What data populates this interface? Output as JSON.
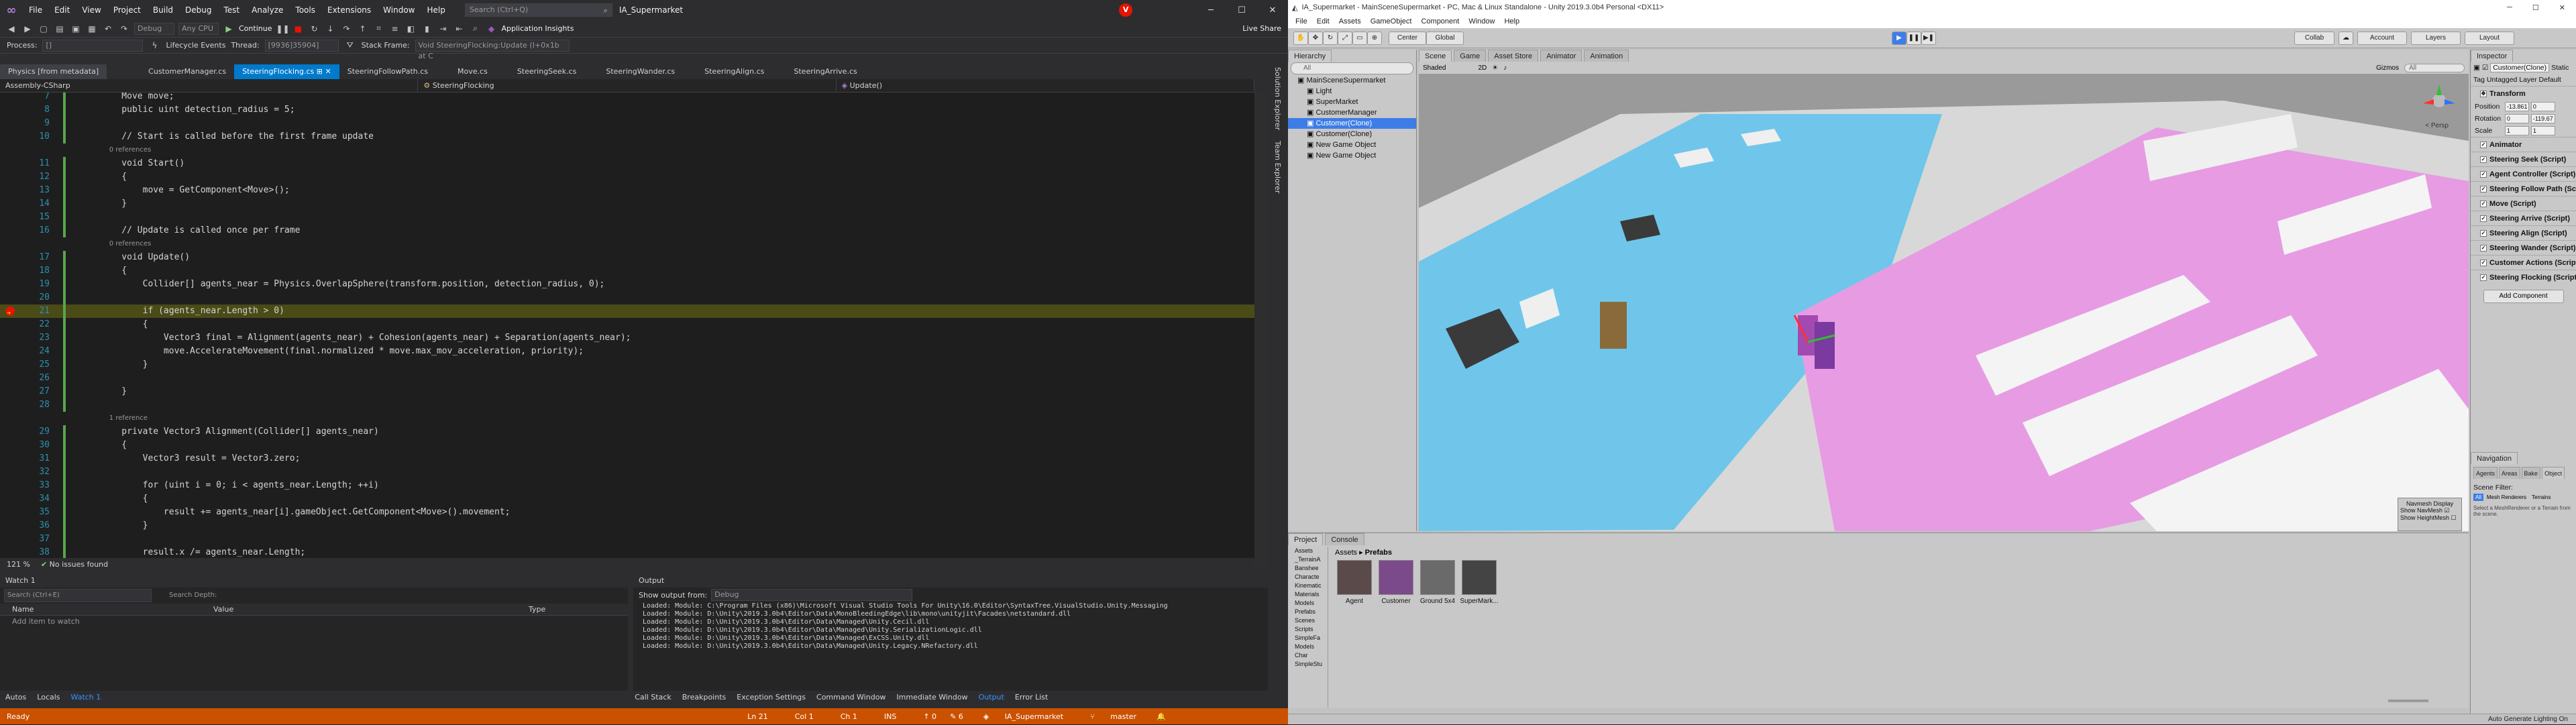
{
  "vs": {
    "menu": [
      "File",
      "Edit",
      "View",
      "Project",
      "Build",
      "Debug",
      "Test",
      "Analyze",
      "Tools",
      "Extensions",
      "Window",
      "Help"
    ],
    "search_placeholder": "Search (Ctrl+Q)",
    "solution": "IA_Supermarket",
    "live_share": "Live Share",
    "toolbar": {
      "config": "Debug",
      "platform": "Any CPU",
      "continue": "Continue",
      "app_insights": "Application Insights"
    },
    "process_bar": {
      "process_label": "Process:",
      "process_value": "[]",
      "lifecycle": "Lifecycle Events",
      "thread_label": "Thread:",
      "thread_value": "[9936]35904]",
      "stackframe_label": "Stack Frame:",
      "stackframe_value": "Void SteeringFlocking:Update (I+0x1b at C"
    },
    "tabs": [
      "Physics [from metadata]",
      "CustomerManager.cs",
      "SteeringFlocking.cs",
      "SteeringFollowPath.cs",
      "Move.cs",
      "SteeringSeek.cs",
      "SteeringWander.cs",
      "SteeringAlign.cs",
      "SteeringArrive.cs"
    ],
    "nav": {
      "project": "Assembly-CSharp",
      "class": "SteeringFlocking",
      "method": "Update()"
    },
    "code_lines": [
      {
        "n": "7",
        "text": "    Move move;"
      },
      {
        "n": "8",
        "text": "    public uint detection_radius = 5;"
      },
      {
        "n": "9",
        "text": ""
      },
      {
        "n": "10",
        "text": "    // Start is called before the first frame update"
      },
      {
        "n": "",
        "text": "    0 references"
      },
      {
        "n": "11",
        "text": "    void Start()"
      },
      {
        "n": "12",
        "text": "    {"
      },
      {
        "n": "13",
        "text": "        move = GetComponent<Move>();"
      },
      {
        "n": "14",
        "text": "    }"
      },
      {
        "n": "15",
        "text": ""
      },
      {
        "n": "16",
        "text": "    // Update is called once per frame"
      },
      {
        "n": "",
        "text": "    0 references"
      },
      {
        "n": "17",
        "text": "    void Update()"
      },
      {
        "n": "18",
        "text": "    {"
      },
      {
        "n": "19",
        "text": "        Collider[] agents_near = Physics.OverlapSphere(transform.position, detection_radius, 0);"
      },
      {
        "n": "20",
        "text": ""
      },
      {
        "n": "21",
        "text": "        if (agents_near.Length > 0)"
      },
      {
        "n": "22",
        "text": "        {"
      },
      {
        "n": "23",
        "text": "            Vector3 final = Alignment(agents_near) + Cohesion(agents_near) + Separation(agents_near);"
      },
      {
        "n": "24",
        "text": "            move.AccelerateMovement(final.normalized * move.max_mov_acceleration, priority);"
      },
      {
        "n": "25",
        "text": "        }"
      },
      {
        "n": "26",
        "text": ""
      },
      {
        "n": "27",
        "text": "    }"
      },
      {
        "n": "28",
        "text": ""
      },
      {
        "n": "",
        "text": "    1 reference"
      },
      {
        "n": "29",
        "text": "    private Vector3 Alignment(Collider[] agents_near)"
      },
      {
        "n": "30",
        "text": "    {"
      },
      {
        "n": "31",
        "text": "        Vector3 result = Vector3.zero;"
      },
      {
        "n": "32",
        "text": ""
      },
      {
        "n": "33",
        "text": "        for (uint i = 0; i < agents_near.Length; ++i)"
      },
      {
        "n": "34",
        "text": "        {"
      },
      {
        "n": "35",
        "text": "            result += agents_near[i].gameObject.GetComponent<Move>().movement;"
      },
      {
        "n": "36",
        "text": "        }"
      },
      {
        "n": "37",
        "text": ""
      },
      {
        "n": "38",
        "text": "        result.x /= agents_near.Length;"
      }
    ],
    "editor_status": {
      "zoom": "121 %",
      "issues": "No issues found"
    },
    "watch": {
      "title": "Watch 1",
      "search_placeholder": "Search (Ctrl+E)",
      "search_depth": "Search Depth:",
      "columns": [
        "Name",
        "Value",
        "Type"
      ],
      "add_item": "Add item to watch"
    },
    "output": {
      "title": "Output",
      "show_from_label": "Show output from:",
      "show_from_value": "Debug",
      "lines": [
        "Loaded: Module: C:\\Program Files (x86)\\Microsoft Visual Studio Tools For Unity\\16.0\\Editor\\SyntaxTree.VisualStudio.Unity.Messaging",
        "Loaded: Module: D:\\Unity\\2019.3.0b4\\Editor\\Data\\MonoBleedingEdge\\lib\\mono\\unityjit\\Facades\\netstandard.dll",
        "Loaded: Module: D:\\Unity\\2019.3.0b4\\Editor\\Data\\Managed\\Unity.Cecil.dll",
        "Loaded: Module: D:\\Unity\\2019.3.0b4\\Editor\\Data\\Managed\\Unity.SerializationLogic.dll",
        "Loaded: Module: D:\\Unity\\2019.3.0b4\\Editor\\Data\\Managed\\ExCSS.Unity.dll",
        "Loaded: Module: D:\\Unity\\2019.3.0b4\\Editor\\Data\\Managed\\Unity.Legacy.NRefactory.dll"
      ]
    },
    "bottom_tabs_left": [
      "Autos",
      "Locals",
      "Watch 1"
    ],
    "bottom_tabs_right": [
      "Call Stack",
      "Breakpoints",
      "Exception Settings",
      "Command Window",
      "Immediate Window",
      "Output",
      "Error List"
    ],
    "status": {
      "ready": "Ready",
      "ln": "Ln 21",
      "col": "Col 1",
      "ch": "Ch 1",
      "ins": "INS",
      "arrows": "↑ 0",
      "pencil": "✎ 6",
      "repo": "IA_Supermarket",
      "branch": "master"
    },
    "right_strip": [
      "Solution Explorer",
      "Team Explorer"
    ]
  },
  "unity": {
    "title": "IA_Supermarket - MainSceneSupermarket - PC, Mac & Linux Standalone - Unity 2019.3.0b4 Personal <DX11>",
    "menu": [
      "File",
      "Edit",
      "Assets",
      "GameObject",
      "Component",
      "Window",
      "Help"
    ],
    "toolbar": {
      "center": "Center",
      "global": "Global",
      "collab": "Collab",
      "account": "Account",
      "layers": "Layers",
      "layout": "Layout"
    },
    "hierarchy": {
      "tab": "Hierarchy",
      "search_placeholder": "All",
      "rows": [
        {
          "label": "MainSceneSupermarket",
          "indent": 1
        },
        {
          "label": "Light",
          "indent": 2
        },
        {
          "label": "SuperMarket",
          "indent": 2
        },
        {
          "label": "CustomerManager",
          "indent": 2
        },
        {
          "label": "Customer(Clone)",
          "indent": 2,
          "selected": true
        },
        {
          "label": "Customer(Clone)",
          "indent": 2
        },
        {
          "label": "New Game Object",
          "indent": 2
        },
        {
          "label": "New Game Object",
          "indent": 2
        }
      ]
    },
    "scene_tabs": [
      "Scene",
      "Game",
      "Asset Store",
      "Animator",
      "Animation"
    ],
    "scene_shading": "Shaded",
    "scene_gizmos": "Gizmos",
    "scene_search": "All",
    "persp_label": "< Persp",
    "navmesh_overlay": {
      "title": "Navmesh Display",
      "show_navmesh": "Show NavMesh",
      "show_heightmesh": "Show HeightMesh"
    },
    "inspector": {
      "tab": "Inspector",
      "object_name": "Customer(Clone)",
      "static_label": "Static",
      "tag_label": "Tag",
      "tag_value": "Untagged",
      "layer_label": "Layer",
      "layer_value": "Default",
      "transform_title": "Transform",
      "position": {
        "label": "Position",
        "x": "-13.861",
        "y": "0",
        "z": "-6.9771"
      },
      "rotation": {
        "label": "Rotation",
        "x": "0",
        "y": "-119.67",
        "z": "0"
      },
      "scale": {
        "label": "Scale",
        "x": "1",
        "y": "1",
        "z": "1"
      },
      "components": [
        "Animator",
        "Steering Seek (Script)",
        "Agent Controller (Script)",
        "Steering Follow Path (Script)",
        "Move (Script)",
        "Steering Arrive (Script)",
        "Steering Align (Script)",
        "Steering Wander (Script)",
        "Customer Actions (Script)",
        "Steering Flocking (Script)"
      ],
      "add_component": "Add Component",
      "navigation": {
        "tab": "Navigation",
        "tabs": [
          "Agents",
          "Areas",
          "Bake",
          "Object"
        ],
        "scene_filter": "Scene Filter:",
        "filters": [
          "All",
          "Mesh Renderers",
          "Terrains"
        ],
        "hint": "Select a MeshRenderer or a Terrain from the scene."
      }
    },
    "project": {
      "tabs": [
        "Project",
        "Console"
      ],
      "breadcrumb": [
        "Assets",
        "Prefabs"
      ],
      "tree": [
        "Assets",
        "_TerrainA",
        "Banshee",
        "Characte",
        "Kinematic",
        "Materials",
        "Models",
        "Prefabs",
        "Scenes",
        "Scripts",
        "SimpleFa",
        "Models",
        "Char",
        "SimpleStu"
      ],
      "assets": [
        "Agent",
        "Customer",
        "Ground 5x4",
        "SuperMark..."
      ]
    },
    "status_right": "Auto Generate Lighting On"
  }
}
